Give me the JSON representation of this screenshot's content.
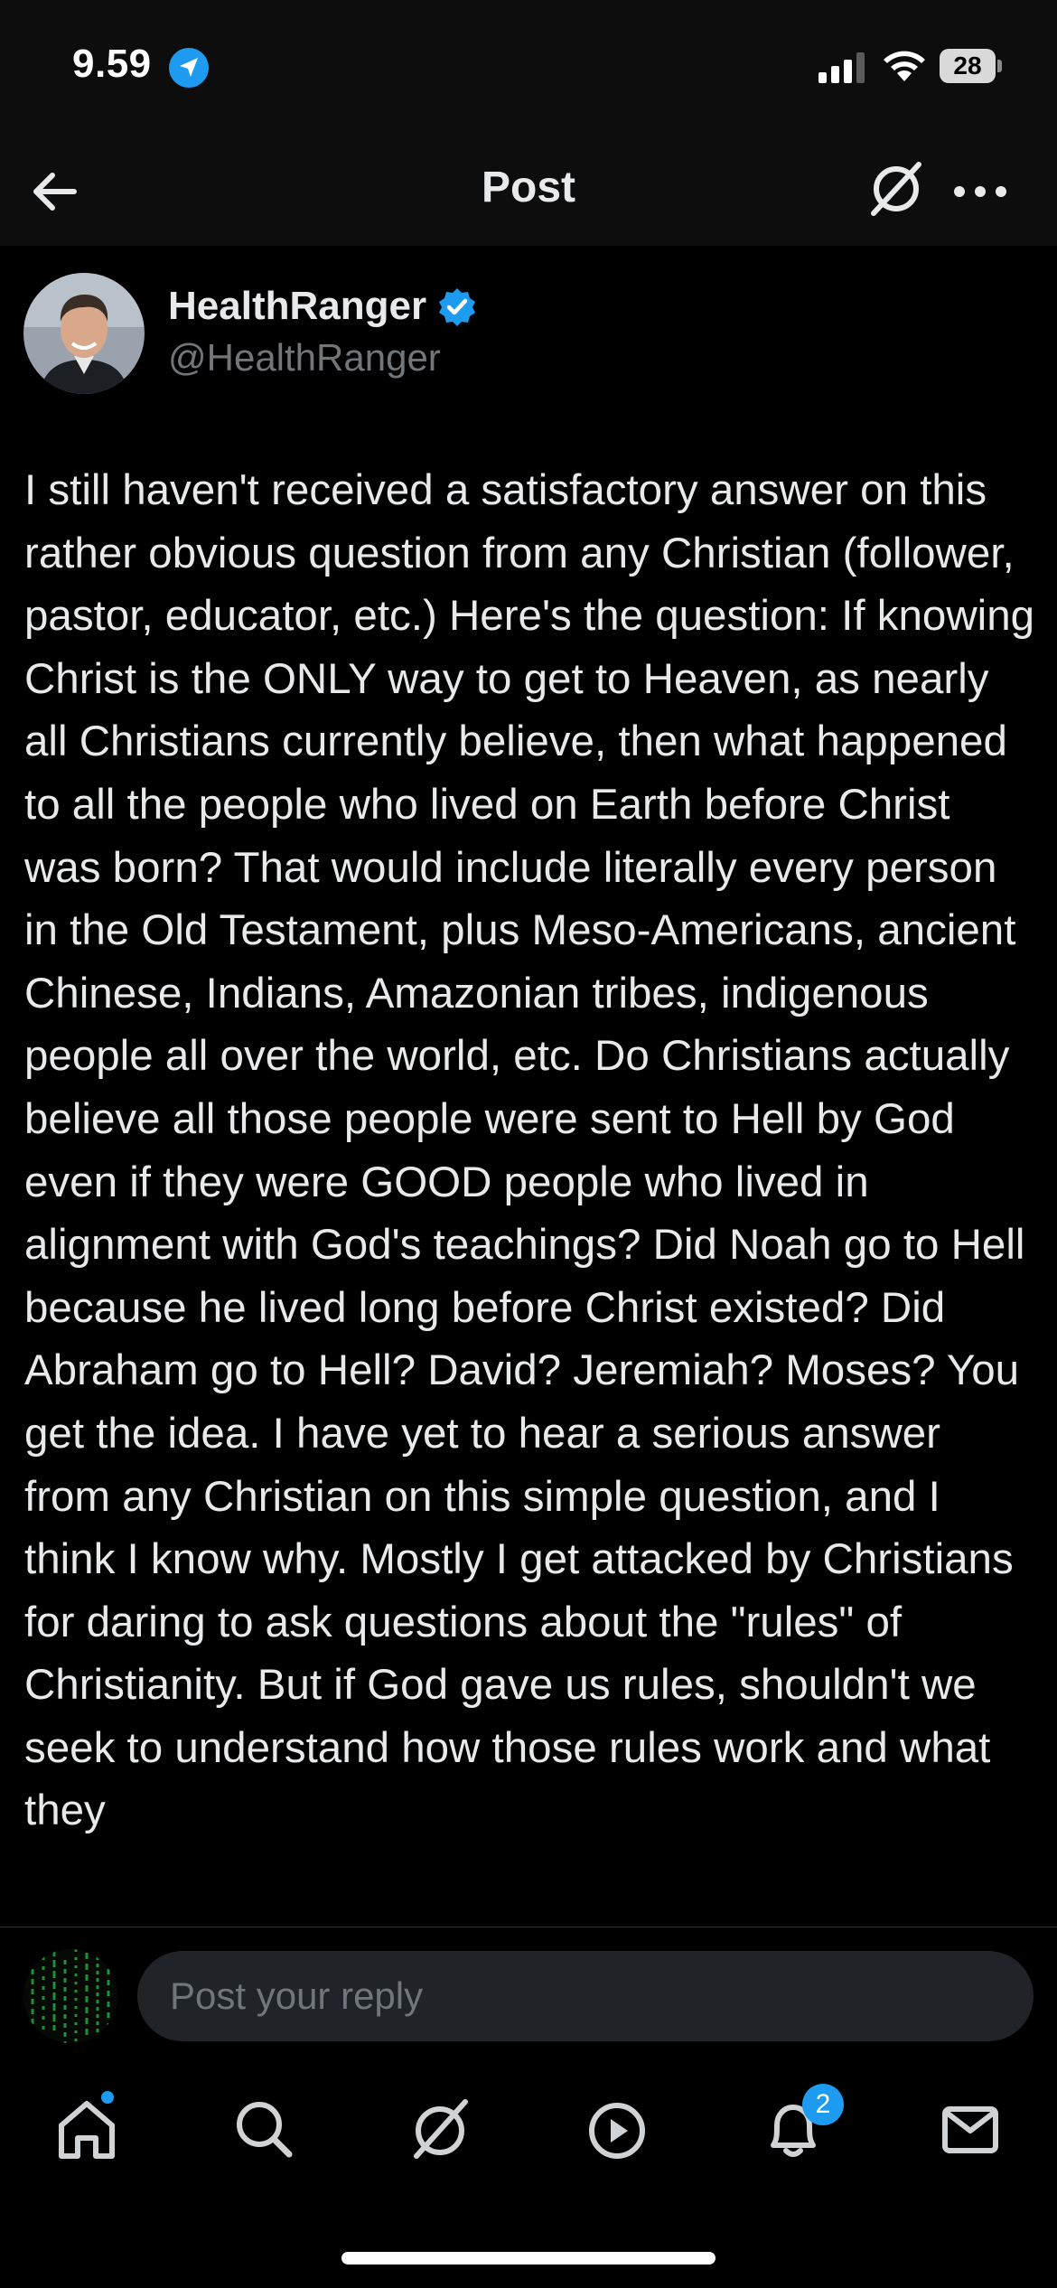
{
  "status_bar": {
    "time": "9.59",
    "battery": "28",
    "location_icon": "location-arrow-icon",
    "signal_icon": "cellular-signal-icon",
    "wifi_icon": "wifi-icon"
  },
  "header": {
    "title": "Post",
    "back_icon": "arrow-left-icon",
    "grok_icon": "grok-icon",
    "more_icon": "more-horizontal-icon"
  },
  "post": {
    "author_name": "HealthRanger",
    "author_handle": "@HealthRanger",
    "verified": true,
    "text": "I still haven't received a satisfactory answer on this rather obvious question from any Christian (follower, pastor, educator, etc.) Here's the question: If knowing Christ is the ONLY way to get to Heaven, as nearly all Christians currently believe, then what happened to all the people who lived on Earth before Christ was born? That would include literally every person in the Old Testament, plus Meso-Americans, ancient Chinese, Indians, Amazonian tribes, indigenous people all over the world, etc. Do Christians actually believe all those people were sent to Hell by God even if they were GOOD people who lived in alignment with God's teachings? Did Noah go to Hell because he lived long before Christ existed? Did Abraham go to Hell? David? Jeremiah? Moses? You get the idea. I have yet to hear a serious answer from any Christian on this simple question, and I think I know why. Mostly I get attacked by Christians for daring to ask questions about the \"rules\" of Christianity. But if God gave us rules, shouldn't we seek to understand how those rules work and what they"
  },
  "reply": {
    "placeholder": "Post your reply",
    "value": ""
  },
  "tab_bar": {
    "items": [
      {
        "name": "home",
        "icon": "home-icon",
        "has_dot": true
      },
      {
        "name": "search",
        "icon": "search-icon"
      },
      {
        "name": "grok",
        "icon": "grok-icon"
      },
      {
        "name": "video",
        "icon": "play-icon"
      },
      {
        "name": "notifications",
        "icon": "bell-icon",
        "badge": "2"
      },
      {
        "name": "messages",
        "icon": "mail-icon"
      }
    ]
  },
  "colors": {
    "background": "#000000",
    "text": "#e7e9ea",
    "muted": "#71767b",
    "accent": "#1d9bf0",
    "input_bg": "#202327"
  }
}
